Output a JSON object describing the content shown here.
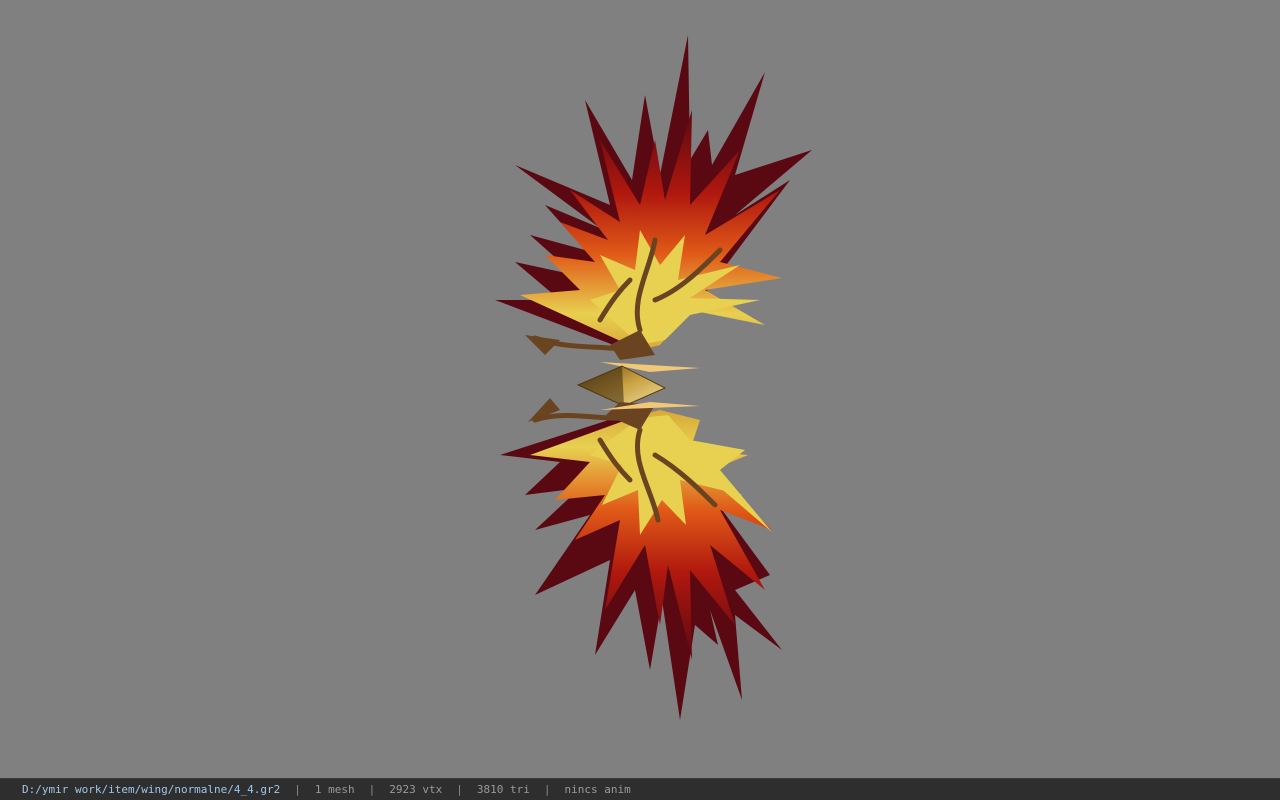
{
  "viewer": {
    "background_color": "#808080",
    "model_icon": "phoenix-wing-model",
    "model_colors": {
      "dark_red": "#6e0a14",
      "red": "#c8200e",
      "orange": "#e8601a",
      "yellow": "#e8d050",
      "bone": "#6a4420"
    }
  },
  "status": {
    "path": "D:/ymir work/item/wing/normalne/4_4.gr2",
    "separator": "|",
    "mesh": "1 mesh",
    "vertices": "2923 vtx",
    "triangles": "3810 tri",
    "anim": "nincs anim"
  }
}
